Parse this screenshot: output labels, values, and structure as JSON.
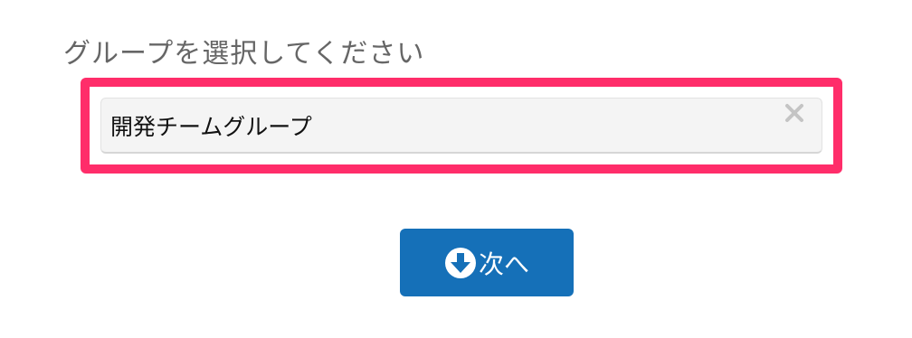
{
  "prompt": {
    "text": "グループを選択してください"
  },
  "group_select": {
    "selected_value": "開発チームグループ",
    "clear_icon": "close-icon",
    "highlight_color": "#ff2d6a"
  },
  "next_button": {
    "label": "次へ",
    "icon": "arrow-down-circle-icon",
    "color": "#1570b8"
  }
}
